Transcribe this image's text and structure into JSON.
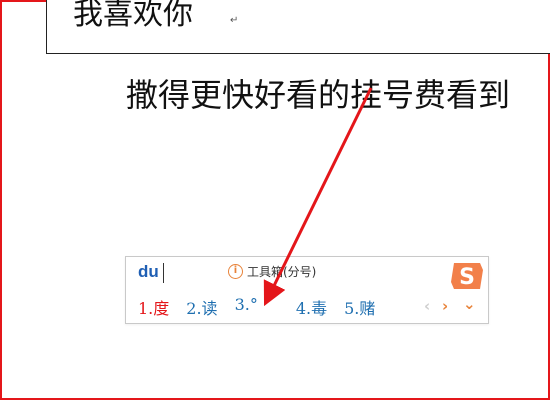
{
  "document": {
    "textbox_text": "我喜欢你",
    "paragraph_mark": "↵",
    "line2": "撒得更快好看的挂号费看到"
  },
  "ime": {
    "input": "du",
    "hint_icon": "info-icon",
    "hint": "工具箱(分号)",
    "logo": "sogou-logo",
    "candidates": [
      "1.度",
      "2.读",
      "3.°",
      "4.毒",
      "5.赌"
    ],
    "selected_index": 0,
    "prev": "‹",
    "next": "›",
    "more": "⌄"
  },
  "colors": {
    "annotation_red": "#e4161a",
    "ime_blue": "#1f6fb0",
    "ime_orange": "#e8833a"
  }
}
